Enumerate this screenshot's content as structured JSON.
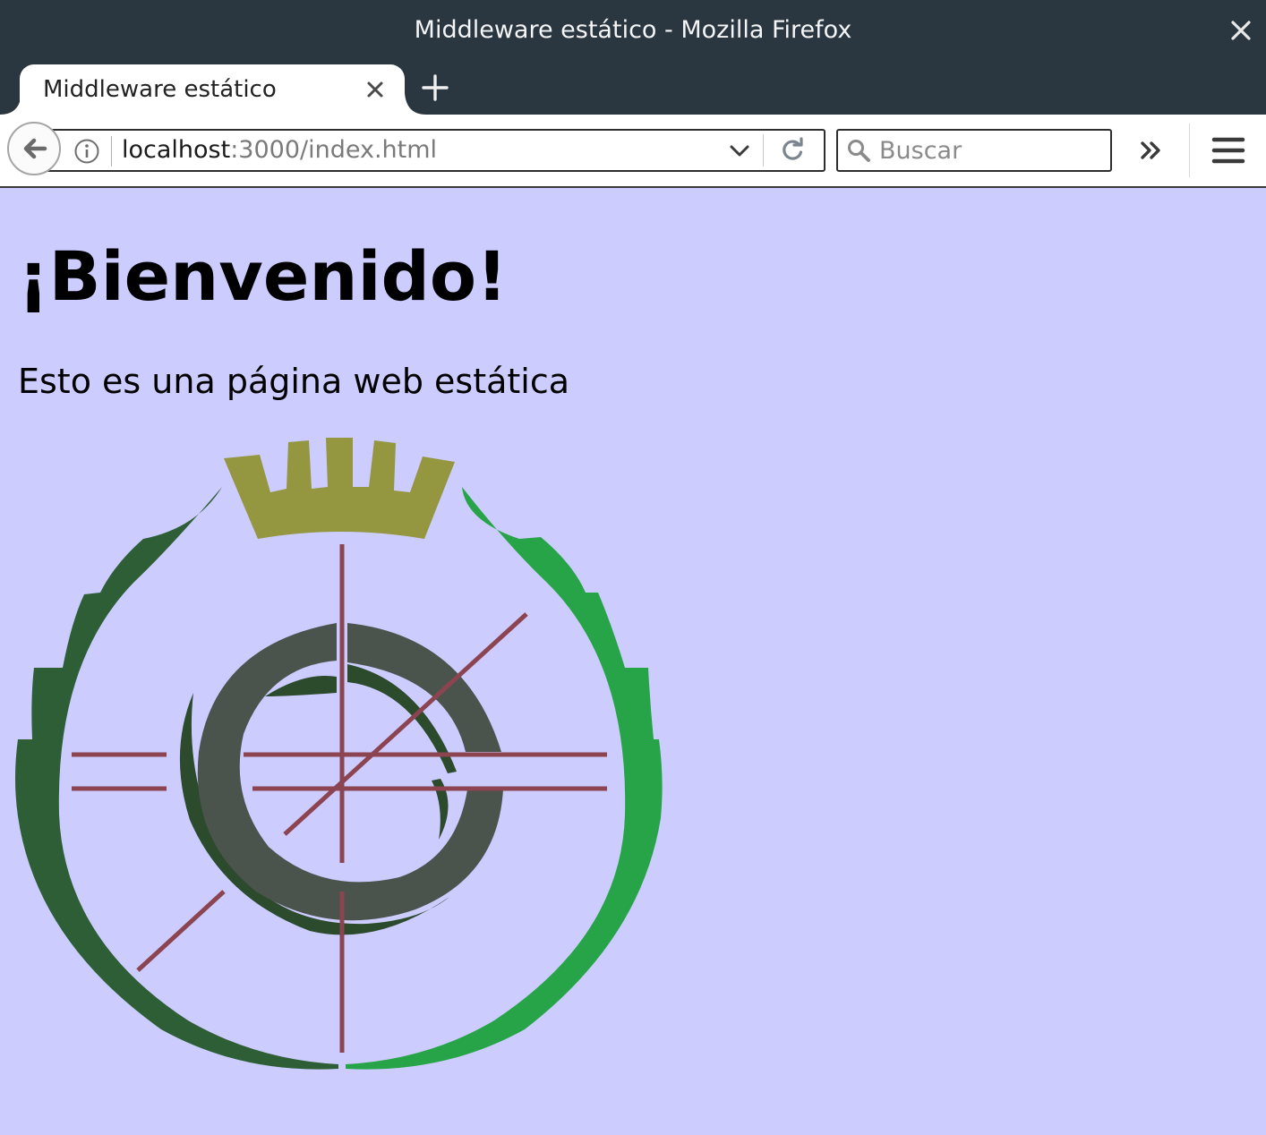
{
  "window": {
    "title": "Middleware estático - Mozilla Firefox"
  },
  "tabs": [
    {
      "label": "Middleware estático",
      "active": true
    }
  ],
  "navbar": {
    "url_host": "localhost",
    "url_rest": ":3000/index.html",
    "search_placeholder": "Buscar"
  },
  "page": {
    "heading": "¡Bienvenido!",
    "paragraph": "Esto es una página web estática",
    "background_color": "#ccccff"
  },
  "logo": {
    "crown_color": "#949640",
    "wreath_left_color": "#2d5e35",
    "wreath_right_color": "#27a348",
    "ring_color": "#4a544c",
    "crescent_color": "#2c4a2c",
    "line_color": "#8c4450"
  },
  "icons": {
    "close": "close-icon",
    "tab_close": "tab-close-icon",
    "new_tab": "plus-icon",
    "back": "back-arrow-icon",
    "info": "info-icon",
    "dropdown": "chevron-down-icon",
    "reload": "reload-icon",
    "search": "search-icon",
    "overflow": "double-chevron-icon",
    "menu": "hamburger-menu-icon"
  }
}
